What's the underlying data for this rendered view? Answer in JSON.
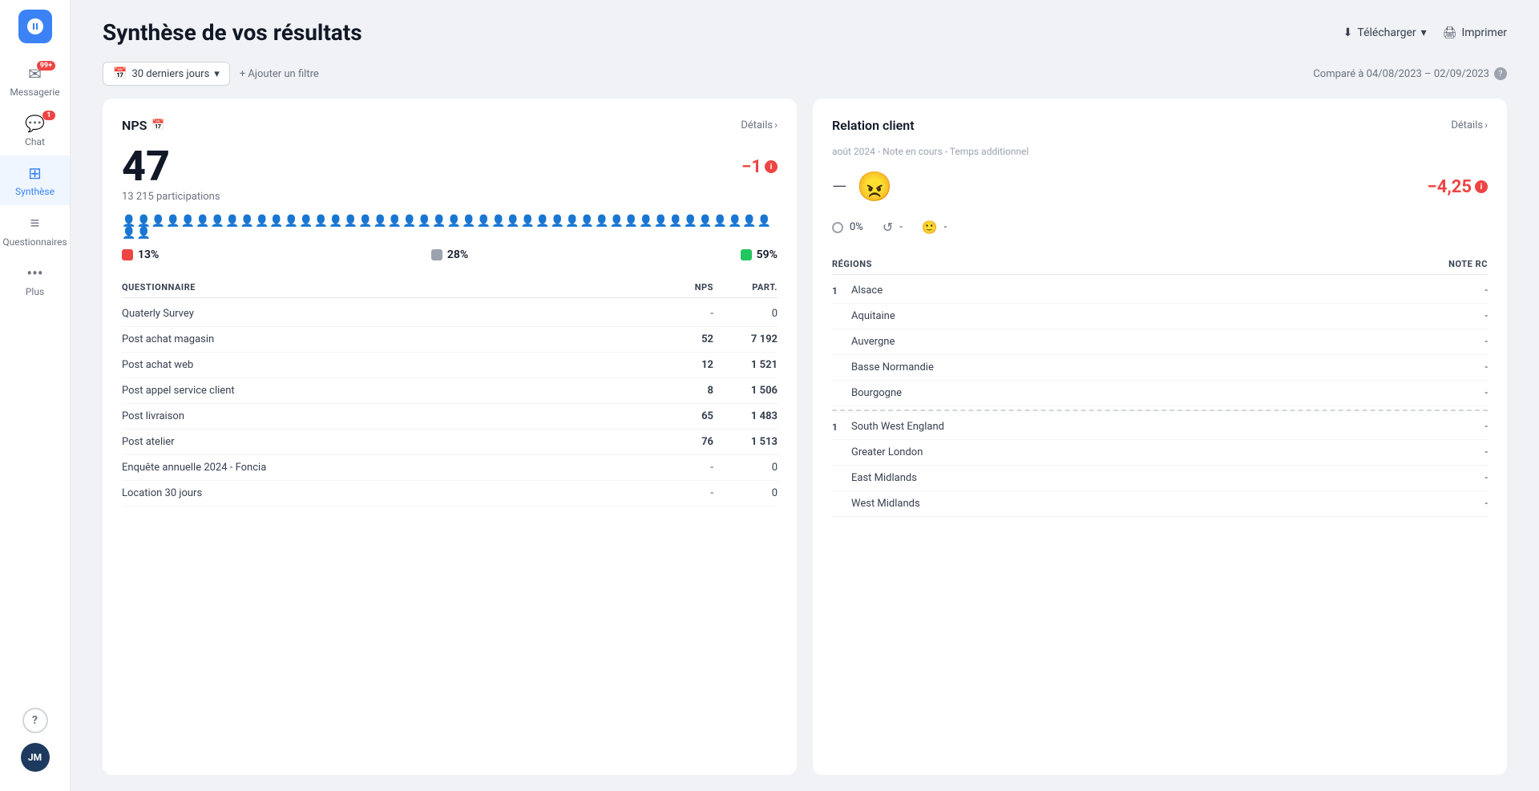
{
  "sidebar": {
    "logo_label": "App Logo",
    "items": [
      {
        "label": "Messagerie",
        "icon": "✉",
        "badge": "99+",
        "active": false,
        "name": "messagerie"
      },
      {
        "label": "Chat",
        "icon": "💬",
        "badge": "1",
        "active": false,
        "name": "chat"
      },
      {
        "label": "Synthèse",
        "icon": "⊞",
        "badge": null,
        "active": true,
        "name": "synthese"
      },
      {
        "label": "Questionnaires",
        "icon": "≡",
        "badge": null,
        "active": false,
        "name": "questionnaires"
      },
      {
        "label": "Plus",
        "icon": "⋯",
        "badge": null,
        "active": false,
        "name": "plus"
      }
    ],
    "avatar_label": "JM",
    "help_label": "?"
  },
  "header": {
    "title": "Synthèse de vos résultats",
    "download_label": "Télécharger",
    "print_label": "Imprimer"
  },
  "filters": {
    "date_filter": "30 derniers jours",
    "add_filter_label": "+ Ajouter un filtre",
    "compare_label": "Comparé à 04/08/2023 – 02/09/2023"
  },
  "nps_card": {
    "title": "NPS",
    "details_label": "Détails",
    "score": "47",
    "delta": "−1",
    "participations": "13 215 participations",
    "red_pct": "13%",
    "gray_pct": "28%",
    "green_pct": "59%",
    "table_header": {
      "questionnaire": "QUESTIONNAIRE",
      "nps": "NPS",
      "part": "Part."
    },
    "table_rows": [
      {
        "name": "Quaterly Survey",
        "nps": "-",
        "part": "0",
        "bold": false
      },
      {
        "name": "Post achat magasin",
        "nps": "52",
        "part": "7 192",
        "bold": true
      },
      {
        "name": "Post achat web",
        "nps": "12",
        "part": "1 521",
        "bold": true
      },
      {
        "name": "Post appel service client",
        "nps": "8",
        "part": "1 506",
        "bold": true
      },
      {
        "name": "Post livraison",
        "nps": "65",
        "part": "1 483",
        "bold": true
      },
      {
        "name": "Post atelier",
        "nps": "76",
        "part": "1 513",
        "bold": true
      },
      {
        "name": "Enquête annuelle 2024 - Foncia",
        "nps": "-",
        "part": "0",
        "bold": false
      },
      {
        "name": "Location 30 jours",
        "nps": "-",
        "part": "0",
        "bold": false
      }
    ]
  },
  "rc_card": {
    "title": "Relation client",
    "details_label": "Détails",
    "subtitle": "août 2024 - Note en cours - Temps additionnel",
    "delta": "−4,25",
    "pct_0": "0%",
    "stat_reload": "-",
    "stat_smile": "-",
    "regions_header_left": "RÉGIONS",
    "regions_header_right": "Note RC",
    "regions": [
      {
        "num": "1",
        "name": "Alsace",
        "note": "-"
      },
      {
        "num": "",
        "name": "Aquitaine",
        "note": "-"
      },
      {
        "num": "",
        "name": "Auvergne",
        "note": "-"
      },
      {
        "num": "",
        "name": "Basse Normandie",
        "note": "-"
      },
      {
        "num": "",
        "name": "Bourgogne",
        "note": "-"
      },
      {
        "num": "1",
        "name": "South West England",
        "note": "-",
        "divider": true
      },
      {
        "num": "",
        "name": "Greater London",
        "note": "-"
      },
      {
        "num": "",
        "name": "East Midlands",
        "note": "-"
      },
      {
        "num": "",
        "name": "West Midlands",
        "note": "-"
      }
    ]
  },
  "colors": {
    "red": "#ef4444",
    "green": "#22c55e",
    "gray": "#9ca3af",
    "blue": "#3b82f6"
  }
}
